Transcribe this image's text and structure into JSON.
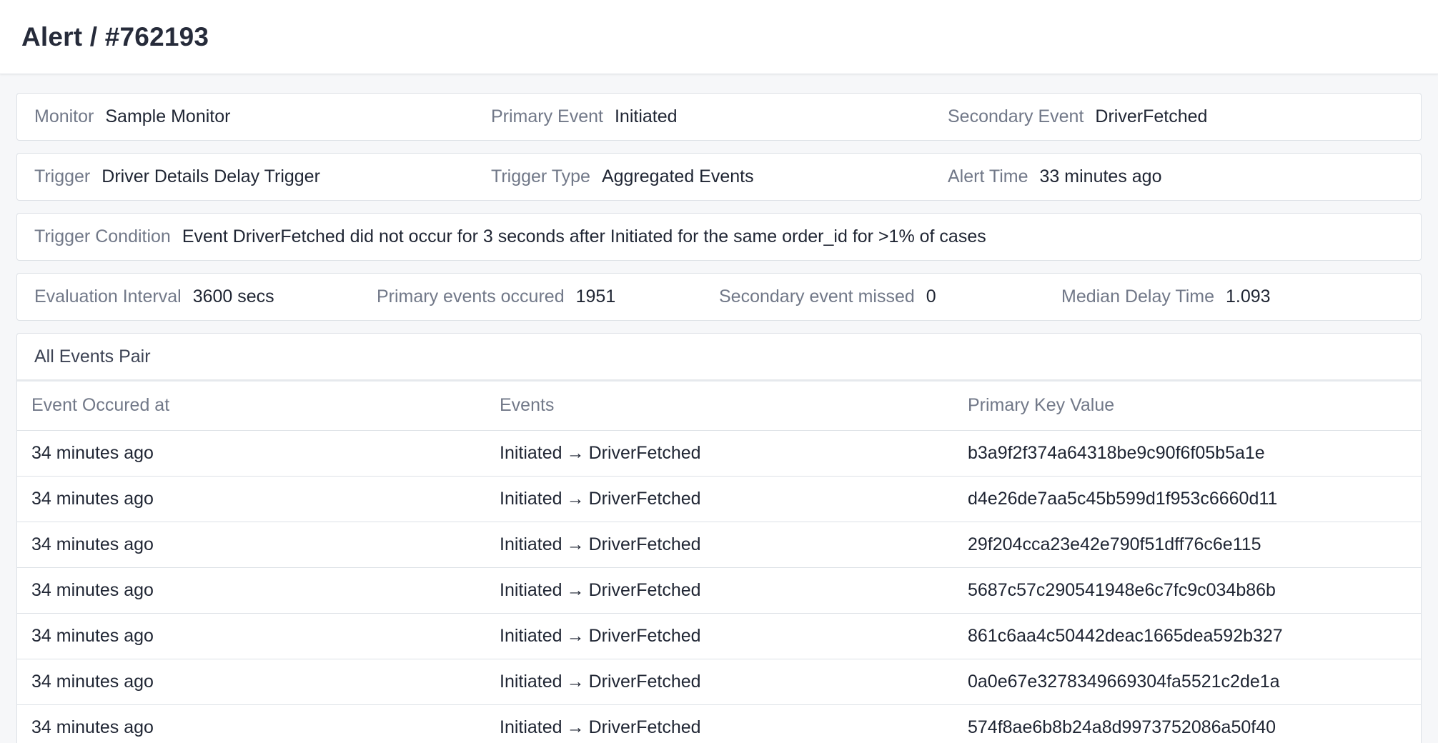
{
  "header": {
    "title": "Alert / #762193"
  },
  "summary": {
    "monitor_label": "Monitor",
    "monitor_value": "Sample Monitor",
    "primary_event_label": "Primary Event",
    "primary_event_value": "Initiated",
    "secondary_event_label": "Secondary Event",
    "secondary_event_value": "DriverFetched"
  },
  "trigger": {
    "trigger_label": "Trigger",
    "trigger_value": "Driver Details Delay Trigger",
    "type_label": "Trigger Type",
    "type_value": "Aggregated Events",
    "time_label": "Alert Time",
    "time_value": "33 minutes ago"
  },
  "condition": {
    "label": "Trigger Condition",
    "value": "Event DriverFetched did not occur for 3 seconds after Initiated for the same order_id for >1% of cases"
  },
  "stats": {
    "interval_label": "Evaluation Interval",
    "interval_value": "3600 secs",
    "primary_label": "Primary events occured",
    "primary_value": "1951",
    "missed_label": "Secondary event missed",
    "missed_value": "0",
    "median_label": "Median Delay Time",
    "median_value": "1.093"
  },
  "events_table": {
    "title": "All Events Pair",
    "columns": [
      "Event Occured at",
      "Events",
      "Primary Key Value"
    ],
    "arrow": "→",
    "rows": [
      {
        "time": "34 minutes ago",
        "from": "Initiated",
        "to": "DriverFetched",
        "key": "b3a9f2f374a64318be9c90f6f05b5a1e"
      },
      {
        "time": "34 minutes ago",
        "from": "Initiated",
        "to": "DriverFetched",
        "key": "d4e26de7aa5c45b599d1f953c6660d11"
      },
      {
        "time": "34 minutes ago",
        "from": "Initiated",
        "to": "DriverFetched",
        "key": "29f204cca23e42e790f51dff76c6e115"
      },
      {
        "time": "34 minutes ago",
        "from": "Initiated",
        "to": "DriverFetched",
        "key": "5687c57c290541948e6c7fc9c034b86b"
      },
      {
        "time": "34 minutes ago",
        "from": "Initiated",
        "to": "DriverFetched",
        "key": "861c6aa4c50442deac1665dea592b327"
      },
      {
        "time": "34 minutes ago",
        "from": "Initiated",
        "to": "DriverFetched",
        "key": "0a0e67e3278349669304fa5521c2de1a"
      },
      {
        "time": "34 minutes ago",
        "from": "Initiated",
        "to": "DriverFetched",
        "key": "574f8ae6b8b24a8d9973752086a50f40"
      }
    ]
  }
}
